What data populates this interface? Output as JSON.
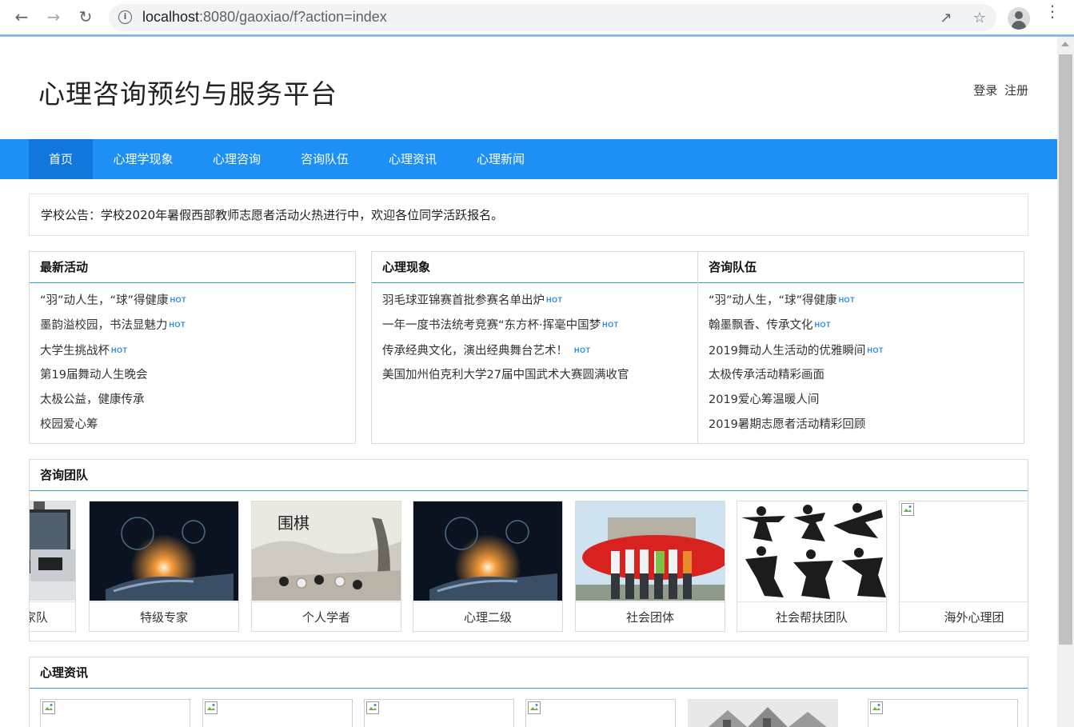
{
  "browser": {
    "back_icon": "arrow-left",
    "forward_icon": "arrow-right",
    "reload_icon": "reload",
    "url_host": "localhost",
    "url_rest": ":8080/gaoxiao/f?action=index"
  },
  "site": {
    "title": "心理咨询预约与服务平台",
    "login": "登录",
    "register": "注册"
  },
  "nav": {
    "items": [
      "首页",
      "心理学现象",
      "心理咨询",
      "咨询队伍",
      "心理资讯",
      "心理新闻"
    ],
    "active_index": 0,
    "color": "#1e8ff5",
    "active_color": "#1177dd"
  },
  "notice": {
    "text": "学校公告：学校2020年暑假西部教师志愿者活动火热进行中，欢迎各位同学活跃报名。"
  },
  "hot_label": "HOT",
  "panels": [
    {
      "title": "最新活动",
      "items": [
        {
          "text": "“羽”动人生，“球”得健康",
          "hot": true
        },
        {
          "text": "墨韵溢校园，书法显魅力",
          "hot": true
        },
        {
          "text": "大学生挑战杯",
          "hot": true
        },
        {
          "text": "第19届舞动人生晚会",
          "hot": false
        },
        {
          "text": "太极公益，健康传承",
          "hot": false
        },
        {
          "text": "校园爱心筹",
          "hot": false
        }
      ]
    },
    {
      "title": "心理现象",
      "items": [
        {
          "text": "羽毛球亚锦赛首批参赛名单出炉",
          "hot": true
        },
        {
          "text": "一年一度书法统考竞赛“东方杯·挥毫中国梦",
          "hot": true
        },
        {
          "text": "传承经典文化，演出经典舞台艺术！",
          "hot": true
        },
        {
          "text": "美国加州伯克利大学27届中国武术大赛圆满收官",
          "hot": false
        }
      ]
    },
    {
      "title": "咨询队伍",
      "items": [
        {
          "text": "“羽”动人生，“球”得健康",
          "hot": true
        },
        {
          "text": "翰墨飘香、传承文化",
          "hot": true
        },
        {
          "text": "2019舞动人生活动的优雅瞬间",
          "hot": true
        },
        {
          "text": "太极传承活动精彩画面",
          "hot": false
        },
        {
          "text": "2019爱心筹温暖人间",
          "hot": false
        },
        {
          "text": "2019暑期志愿者活动精彩回顾",
          "hot": false
        }
      ]
    }
  ],
  "team": {
    "title": "咨询团队",
    "cards": [
      {
        "caption": "家队",
        "image": "computer-workstation-photo"
      },
      {
        "caption": "特级专家",
        "image": "tech-globe-hand-photo"
      },
      {
        "caption": "个人学者",
        "image": "go-game-ink-painting"
      },
      {
        "caption": "心理二级",
        "image": "tech-globe-hand-photo"
      },
      {
        "caption": "社会团体",
        "image": "group-outdoor-photo"
      },
      {
        "caption": "社会帮扶团队",
        "image": "martial-arts-silhouettes"
      },
      {
        "caption": "海外心理团",
        "image": "broken-image"
      }
    ]
  },
  "news": {
    "title": "心理资讯",
    "cards": [
      "broken-image",
      "broken-image",
      "broken-image",
      "broken-image",
      "building-photo",
      "broken-image"
    ]
  }
}
